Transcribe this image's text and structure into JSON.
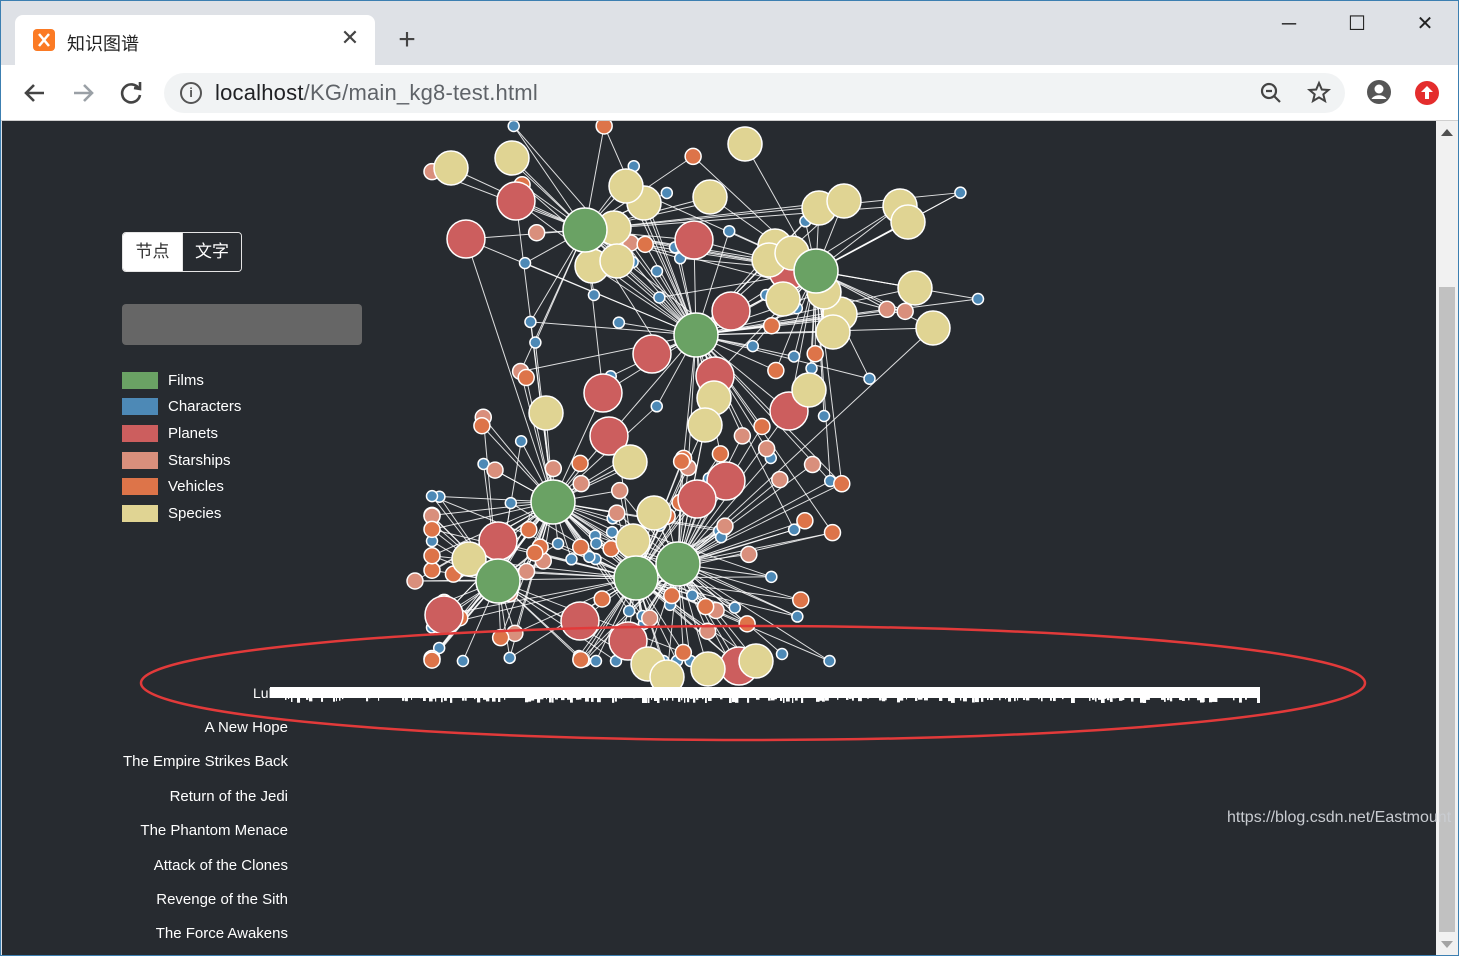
{
  "browser": {
    "tab_title": "知识图谱",
    "url_host": "localhost",
    "url_path": "/KG/main_kg8-test.html",
    "window_controls": {
      "minimize": "─",
      "maximize": "☐",
      "close": "✕"
    },
    "new_tab": "+",
    "tab_close": "✕"
  },
  "sidebar": {
    "toggle": {
      "node": "节点",
      "text": "文字"
    },
    "search": {
      "value": "",
      "placeholder": ""
    },
    "legend": [
      {
        "label": "Films",
        "color": "#6aa264"
      },
      {
        "label": "Characters",
        "color": "#4d89b6"
      },
      {
        "label": "Planets",
        "color": "#cc5e5e"
      },
      {
        "label": "Starships",
        "color": "#d98f7c"
      },
      {
        "label": "Vehicles",
        "color": "#dd7449"
      },
      {
        "label": "Species",
        "color": "#e0d493"
      }
    ]
  },
  "overlap_label": "Luke",
  "films": [
    "A New Hope",
    "The Empire Strikes Back",
    "Return of the Jedi",
    "The Phantom Menace",
    "Attack of the Clones",
    "Revenge of the Sith",
    "The Force Awakens"
  ],
  "watermark": "https://blog.csdn.net/Eastmount",
  "colors": {
    "page_bg": "#272b30",
    "edge": "#ffffff",
    "node_stroke": "#ffffff",
    "highlight_ellipse": "#e23a3a"
  }
}
